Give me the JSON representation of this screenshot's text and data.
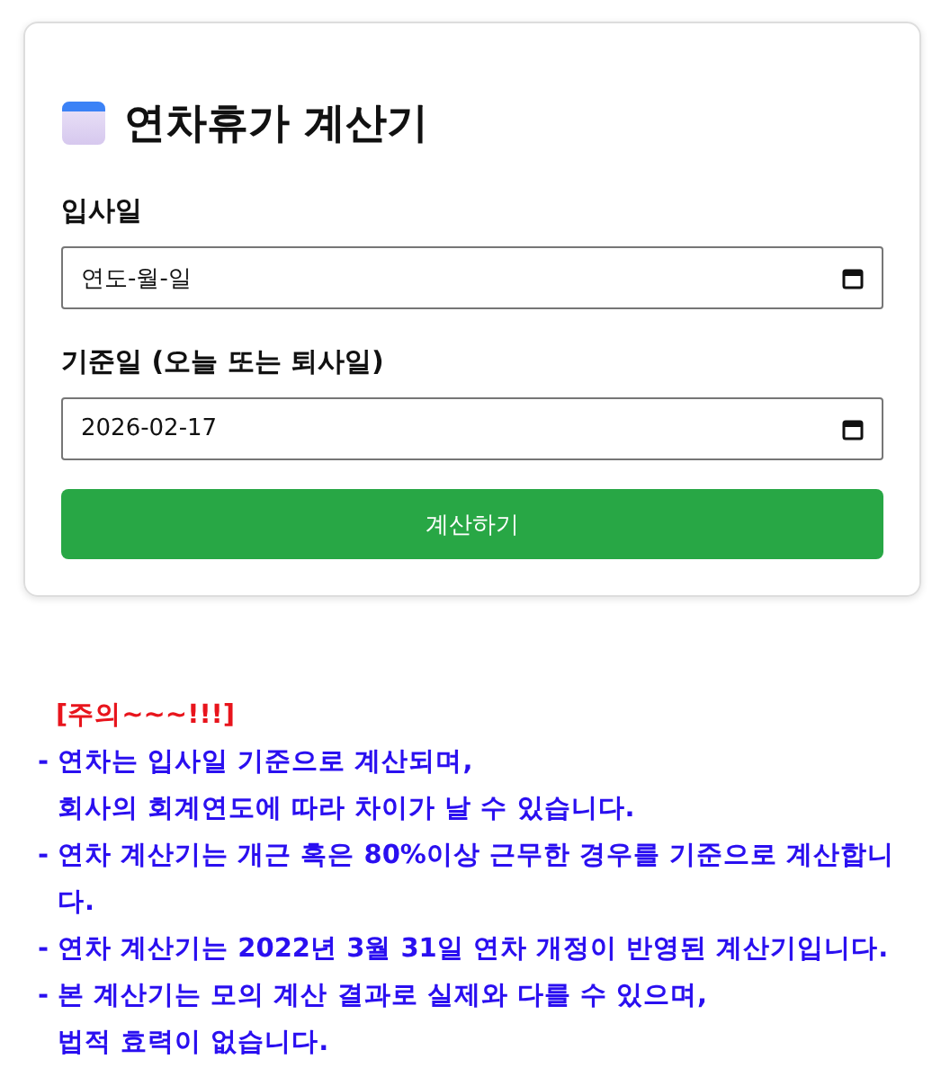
{
  "title": "연차휴가 계산기",
  "fields": [
    {
      "label": "입사일",
      "placeholder": "연도-월-일"
    },
    {
      "label": "기준일 (오늘 또는 퇴사일)",
      "value": "2026-02-17"
    }
  ],
  "button": "계산하기",
  "notice": {
    "heading": "[주의~~~!!!]",
    "items": [
      {
        "lines": [
          "- 연차는 입사일 기준으로 계산되며,",
          "회사의 회계연도에 따라 차이가 날 수 있습니다."
        ]
      },
      {
        "lines": [
          "- 연차 계산기는 개근 혹은 80%이상 근무한 경우를 기준으로 계산합니다."
        ]
      },
      {
        "lines": [
          "- 연차 계산기는 2022년 3월 31일 연차 개정이 반영된 계산기입니다."
        ]
      },
      {
        "lines": [
          "- 본 계산기는 모의 계산 결과로 실제와 다를 수 있으며,",
          "법적 효력이 없습니다."
        ]
      }
    ]
  }
}
